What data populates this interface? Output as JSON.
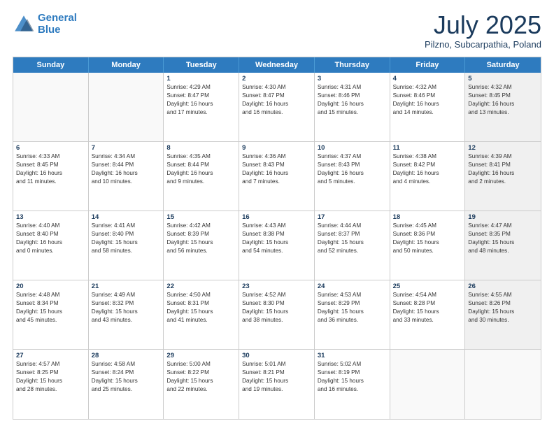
{
  "header": {
    "logo_line1": "General",
    "logo_line2": "Blue",
    "month": "July 2025",
    "location": "Pilzno, Subcarpathia, Poland"
  },
  "days_of_week": [
    "Sunday",
    "Monday",
    "Tuesday",
    "Wednesday",
    "Thursday",
    "Friday",
    "Saturday"
  ],
  "weeks": [
    [
      {
        "day": "",
        "lines": [],
        "shaded": false,
        "empty": true
      },
      {
        "day": "",
        "lines": [],
        "shaded": false,
        "empty": true
      },
      {
        "day": "1",
        "lines": [
          "Sunrise: 4:29 AM",
          "Sunset: 8:47 PM",
          "Daylight: 16 hours",
          "and 17 minutes."
        ],
        "shaded": false,
        "empty": false
      },
      {
        "day": "2",
        "lines": [
          "Sunrise: 4:30 AM",
          "Sunset: 8:47 PM",
          "Daylight: 16 hours",
          "and 16 minutes."
        ],
        "shaded": false,
        "empty": false
      },
      {
        "day": "3",
        "lines": [
          "Sunrise: 4:31 AM",
          "Sunset: 8:46 PM",
          "Daylight: 16 hours",
          "and 15 minutes."
        ],
        "shaded": false,
        "empty": false
      },
      {
        "day": "4",
        "lines": [
          "Sunrise: 4:32 AM",
          "Sunset: 8:46 PM",
          "Daylight: 16 hours",
          "and 14 minutes."
        ],
        "shaded": false,
        "empty": false
      },
      {
        "day": "5",
        "lines": [
          "Sunrise: 4:32 AM",
          "Sunset: 8:45 PM",
          "Daylight: 16 hours",
          "and 13 minutes."
        ],
        "shaded": true,
        "empty": false
      }
    ],
    [
      {
        "day": "6",
        "lines": [
          "Sunrise: 4:33 AM",
          "Sunset: 8:45 PM",
          "Daylight: 16 hours",
          "and 11 minutes."
        ],
        "shaded": false,
        "empty": false
      },
      {
        "day": "7",
        "lines": [
          "Sunrise: 4:34 AM",
          "Sunset: 8:44 PM",
          "Daylight: 16 hours",
          "and 10 minutes."
        ],
        "shaded": false,
        "empty": false
      },
      {
        "day": "8",
        "lines": [
          "Sunrise: 4:35 AM",
          "Sunset: 8:44 PM",
          "Daylight: 16 hours",
          "and 9 minutes."
        ],
        "shaded": false,
        "empty": false
      },
      {
        "day": "9",
        "lines": [
          "Sunrise: 4:36 AM",
          "Sunset: 8:43 PM",
          "Daylight: 16 hours",
          "and 7 minutes."
        ],
        "shaded": false,
        "empty": false
      },
      {
        "day": "10",
        "lines": [
          "Sunrise: 4:37 AM",
          "Sunset: 8:43 PM",
          "Daylight: 16 hours",
          "and 5 minutes."
        ],
        "shaded": false,
        "empty": false
      },
      {
        "day": "11",
        "lines": [
          "Sunrise: 4:38 AM",
          "Sunset: 8:42 PM",
          "Daylight: 16 hours",
          "and 4 minutes."
        ],
        "shaded": false,
        "empty": false
      },
      {
        "day": "12",
        "lines": [
          "Sunrise: 4:39 AM",
          "Sunset: 8:41 PM",
          "Daylight: 16 hours",
          "and 2 minutes."
        ],
        "shaded": true,
        "empty": false
      }
    ],
    [
      {
        "day": "13",
        "lines": [
          "Sunrise: 4:40 AM",
          "Sunset: 8:40 PM",
          "Daylight: 16 hours",
          "and 0 minutes."
        ],
        "shaded": false,
        "empty": false
      },
      {
        "day": "14",
        "lines": [
          "Sunrise: 4:41 AM",
          "Sunset: 8:40 PM",
          "Daylight: 15 hours",
          "and 58 minutes."
        ],
        "shaded": false,
        "empty": false
      },
      {
        "day": "15",
        "lines": [
          "Sunrise: 4:42 AM",
          "Sunset: 8:39 PM",
          "Daylight: 15 hours",
          "and 56 minutes."
        ],
        "shaded": false,
        "empty": false
      },
      {
        "day": "16",
        "lines": [
          "Sunrise: 4:43 AM",
          "Sunset: 8:38 PM",
          "Daylight: 15 hours",
          "and 54 minutes."
        ],
        "shaded": false,
        "empty": false
      },
      {
        "day": "17",
        "lines": [
          "Sunrise: 4:44 AM",
          "Sunset: 8:37 PM",
          "Daylight: 15 hours",
          "and 52 minutes."
        ],
        "shaded": false,
        "empty": false
      },
      {
        "day": "18",
        "lines": [
          "Sunrise: 4:45 AM",
          "Sunset: 8:36 PM",
          "Daylight: 15 hours",
          "and 50 minutes."
        ],
        "shaded": false,
        "empty": false
      },
      {
        "day": "19",
        "lines": [
          "Sunrise: 4:47 AM",
          "Sunset: 8:35 PM",
          "Daylight: 15 hours",
          "and 48 minutes."
        ],
        "shaded": true,
        "empty": false
      }
    ],
    [
      {
        "day": "20",
        "lines": [
          "Sunrise: 4:48 AM",
          "Sunset: 8:34 PM",
          "Daylight: 15 hours",
          "and 45 minutes."
        ],
        "shaded": false,
        "empty": false
      },
      {
        "day": "21",
        "lines": [
          "Sunrise: 4:49 AM",
          "Sunset: 8:32 PM",
          "Daylight: 15 hours",
          "and 43 minutes."
        ],
        "shaded": false,
        "empty": false
      },
      {
        "day": "22",
        "lines": [
          "Sunrise: 4:50 AM",
          "Sunset: 8:31 PM",
          "Daylight: 15 hours",
          "and 41 minutes."
        ],
        "shaded": false,
        "empty": false
      },
      {
        "day": "23",
        "lines": [
          "Sunrise: 4:52 AM",
          "Sunset: 8:30 PM",
          "Daylight: 15 hours",
          "and 38 minutes."
        ],
        "shaded": false,
        "empty": false
      },
      {
        "day": "24",
        "lines": [
          "Sunrise: 4:53 AM",
          "Sunset: 8:29 PM",
          "Daylight: 15 hours",
          "and 36 minutes."
        ],
        "shaded": false,
        "empty": false
      },
      {
        "day": "25",
        "lines": [
          "Sunrise: 4:54 AM",
          "Sunset: 8:28 PM",
          "Daylight: 15 hours",
          "and 33 minutes."
        ],
        "shaded": false,
        "empty": false
      },
      {
        "day": "26",
        "lines": [
          "Sunrise: 4:55 AM",
          "Sunset: 8:26 PM",
          "Daylight: 15 hours",
          "and 30 minutes."
        ],
        "shaded": true,
        "empty": false
      }
    ],
    [
      {
        "day": "27",
        "lines": [
          "Sunrise: 4:57 AM",
          "Sunset: 8:25 PM",
          "Daylight: 15 hours",
          "and 28 minutes."
        ],
        "shaded": false,
        "empty": false
      },
      {
        "day": "28",
        "lines": [
          "Sunrise: 4:58 AM",
          "Sunset: 8:24 PM",
          "Daylight: 15 hours",
          "and 25 minutes."
        ],
        "shaded": false,
        "empty": false
      },
      {
        "day": "29",
        "lines": [
          "Sunrise: 5:00 AM",
          "Sunset: 8:22 PM",
          "Daylight: 15 hours",
          "and 22 minutes."
        ],
        "shaded": false,
        "empty": false
      },
      {
        "day": "30",
        "lines": [
          "Sunrise: 5:01 AM",
          "Sunset: 8:21 PM",
          "Daylight: 15 hours",
          "and 19 minutes."
        ],
        "shaded": false,
        "empty": false
      },
      {
        "day": "31",
        "lines": [
          "Sunrise: 5:02 AM",
          "Sunset: 8:19 PM",
          "Daylight: 15 hours",
          "and 16 minutes."
        ],
        "shaded": false,
        "empty": false
      },
      {
        "day": "",
        "lines": [],
        "shaded": false,
        "empty": true
      },
      {
        "day": "",
        "lines": [],
        "shaded": true,
        "empty": true
      }
    ]
  ]
}
